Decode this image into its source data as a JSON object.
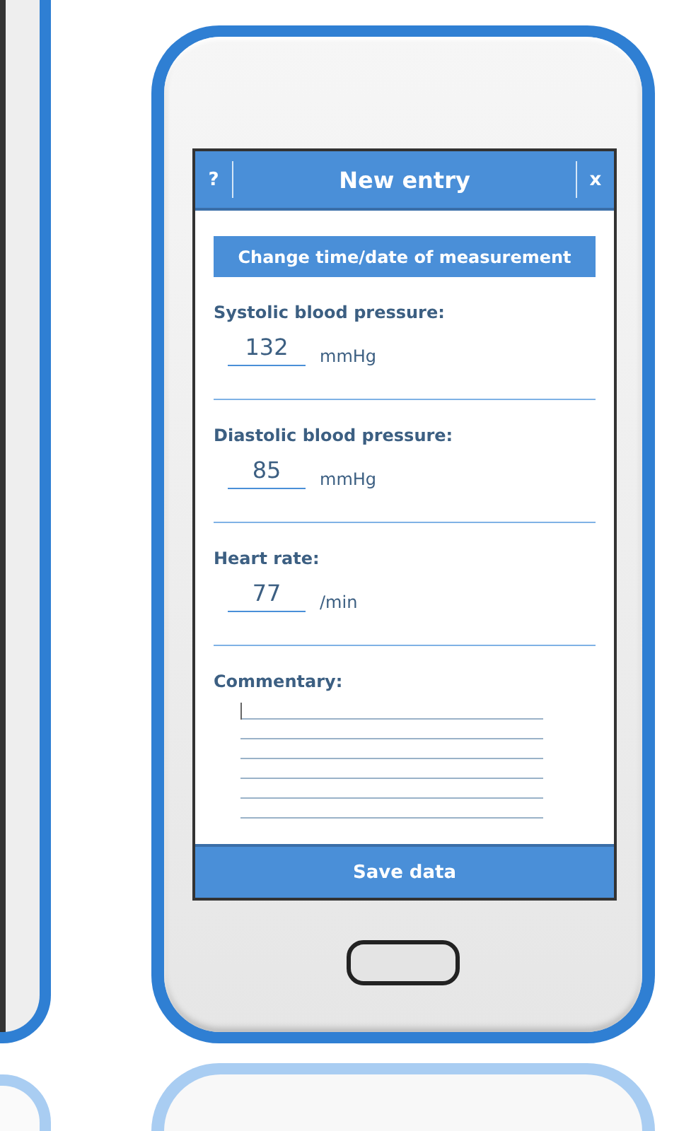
{
  "header": {
    "help": "?",
    "title": "New entry",
    "close": "x"
  },
  "change_button": "Change time/date of measurement",
  "fields": [
    {
      "label": "Systolic blood pressure:",
      "value": "132",
      "unit": "mmHg"
    },
    {
      "label": "Diastolic blood pressure:",
      "value": "85",
      "unit": "mmHg"
    },
    {
      "label": "Heart rate:",
      "value": "77",
      "unit": "/min"
    }
  ],
  "commentary": {
    "label": "Commentary:"
  },
  "save_button": "Save data"
}
